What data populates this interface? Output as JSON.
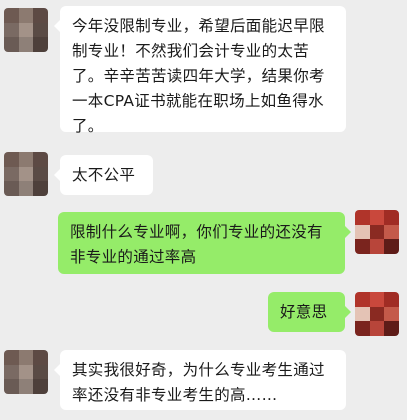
{
  "messages": [
    {
      "side": "left",
      "text": "今年没限制专业，希望后面能迟早限制专业！不然我们会计专业的太苦了。辛辛苦苦读四年大学，结果你考一本CPA证书就能在职场上如鱼得水了。"
    },
    {
      "side": "left",
      "text": "太不公平"
    },
    {
      "side": "right",
      "text": "限制什么专业啊，你们专业的还没有非专业的通过率高"
    },
    {
      "side": "right",
      "text": "好意思"
    },
    {
      "side": "left",
      "text": "其实我很好奇，为什么专业考生通过率还没有非专业考生的高……"
    }
  ],
  "colors": {
    "background": "#ededed",
    "bubble_left": "#ffffff",
    "bubble_right": "#95ec69"
  },
  "avatars": {
    "left": [
      "#6e5a52",
      "#8c7a70",
      "#5d4a44",
      "#7a6a63",
      "#a39288",
      "#5a4b45",
      "#6a5b55",
      "#8e8078",
      "#4e403b"
    ],
    "right": [
      "#b0342a",
      "#c9483c",
      "#a02c24",
      "#e4c3b5",
      "#8a2a22",
      "#c45a4a",
      "#7a241e",
      "#b8453a",
      "#5e1c18"
    ]
  }
}
